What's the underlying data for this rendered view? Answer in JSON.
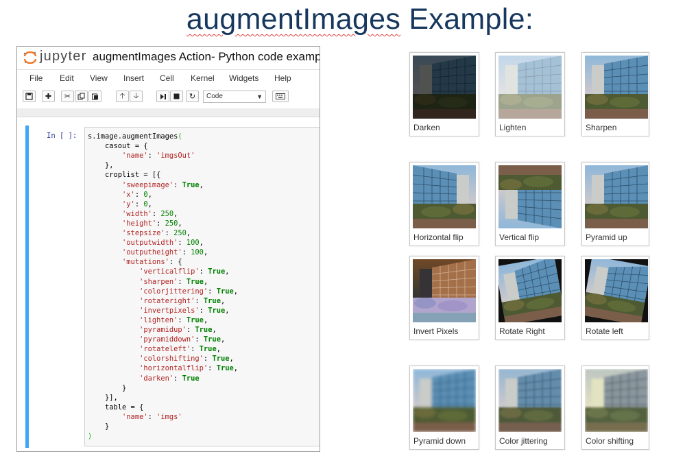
{
  "slide": {
    "title_underlined": "augmentImages",
    "title_rest": " Example:"
  },
  "jupyter": {
    "logo_text": "jupyter",
    "notebook_title": "augmentImages Action- Python code example",
    "menu": [
      "File",
      "Edit",
      "View",
      "Insert",
      "Cell",
      "Kernel",
      "Widgets",
      "Help"
    ],
    "cell_type": "Code",
    "prompt": "In [ ]:",
    "code_lines": [
      "s.image.augmentImages(",
      "    casout = {",
      "        'name': 'imgsOut'",
      "    },",
      "    croplist = [{",
      "        'sweepimage': True,",
      "        'x': 0,",
      "        'y': 0,",
      "        'width': 250,",
      "        'height': 250,",
      "        'stepsize': 250,",
      "        'outputwidth': 100,",
      "        'outputheight': 100,",
      "        'mutations': {",
      "            'verticalflip': True,",
      "            'sharpen': True,",
      "            'colorjittering': True,",
      "            'rotateright': True,",
      "            'invertpixels': True,",
      "            'lighten': True,",
      "            'pyramidup': True,",
      "            'pyramiddown': True,",
      "            'rotateleft': True,",
      "            'colorshifting': True,",
      "            'horizontalflip': True,",
      "            'darken': True",
      "        }",
      "    }],",
      "    table = {",
      "        'name': 'imgs'",
      "    }",
      ")"
    ]
  },
  "thumbnails": [
    {
      "label": "Darken",
      "variant": "darken"
    },
    {
      "label": "Lighten",
      "variant": "lighten"
    },
    {
      "label": "Sharpen",
      "variant": "sharpen"
    },
    {
      "label": "Horizontal flip",
      "variant": "hflip"
    },
    {
      "label": "Vertical flip",
      "variant": "vflip"
    },
    {
      "label": "Pyramid up",
      "variant": "pyrup"
    },
    {
      "label": "Invert Pixels",
      "variant": "invert"
    },
    {
      "label": "Rotate Right",
      "variant": "rotright"
    },
    {
      "label": "Rotate left",
      "variant": "rotleft"
    },
    {
      "label": "Pyramid down",
      "variant": "pyrdown"
    },
    {
      "label": "Color jittering",
      "variant": "jitter"
    },
    {
      "label": "Color shifting",
      "variant": "shift"
    }
  ],
  "colors": {
    "title": "#17375e",
    "cell_border": "#42a5f5",
    "string": "#b22222",
    "keyword": "#008000"
  }
}
